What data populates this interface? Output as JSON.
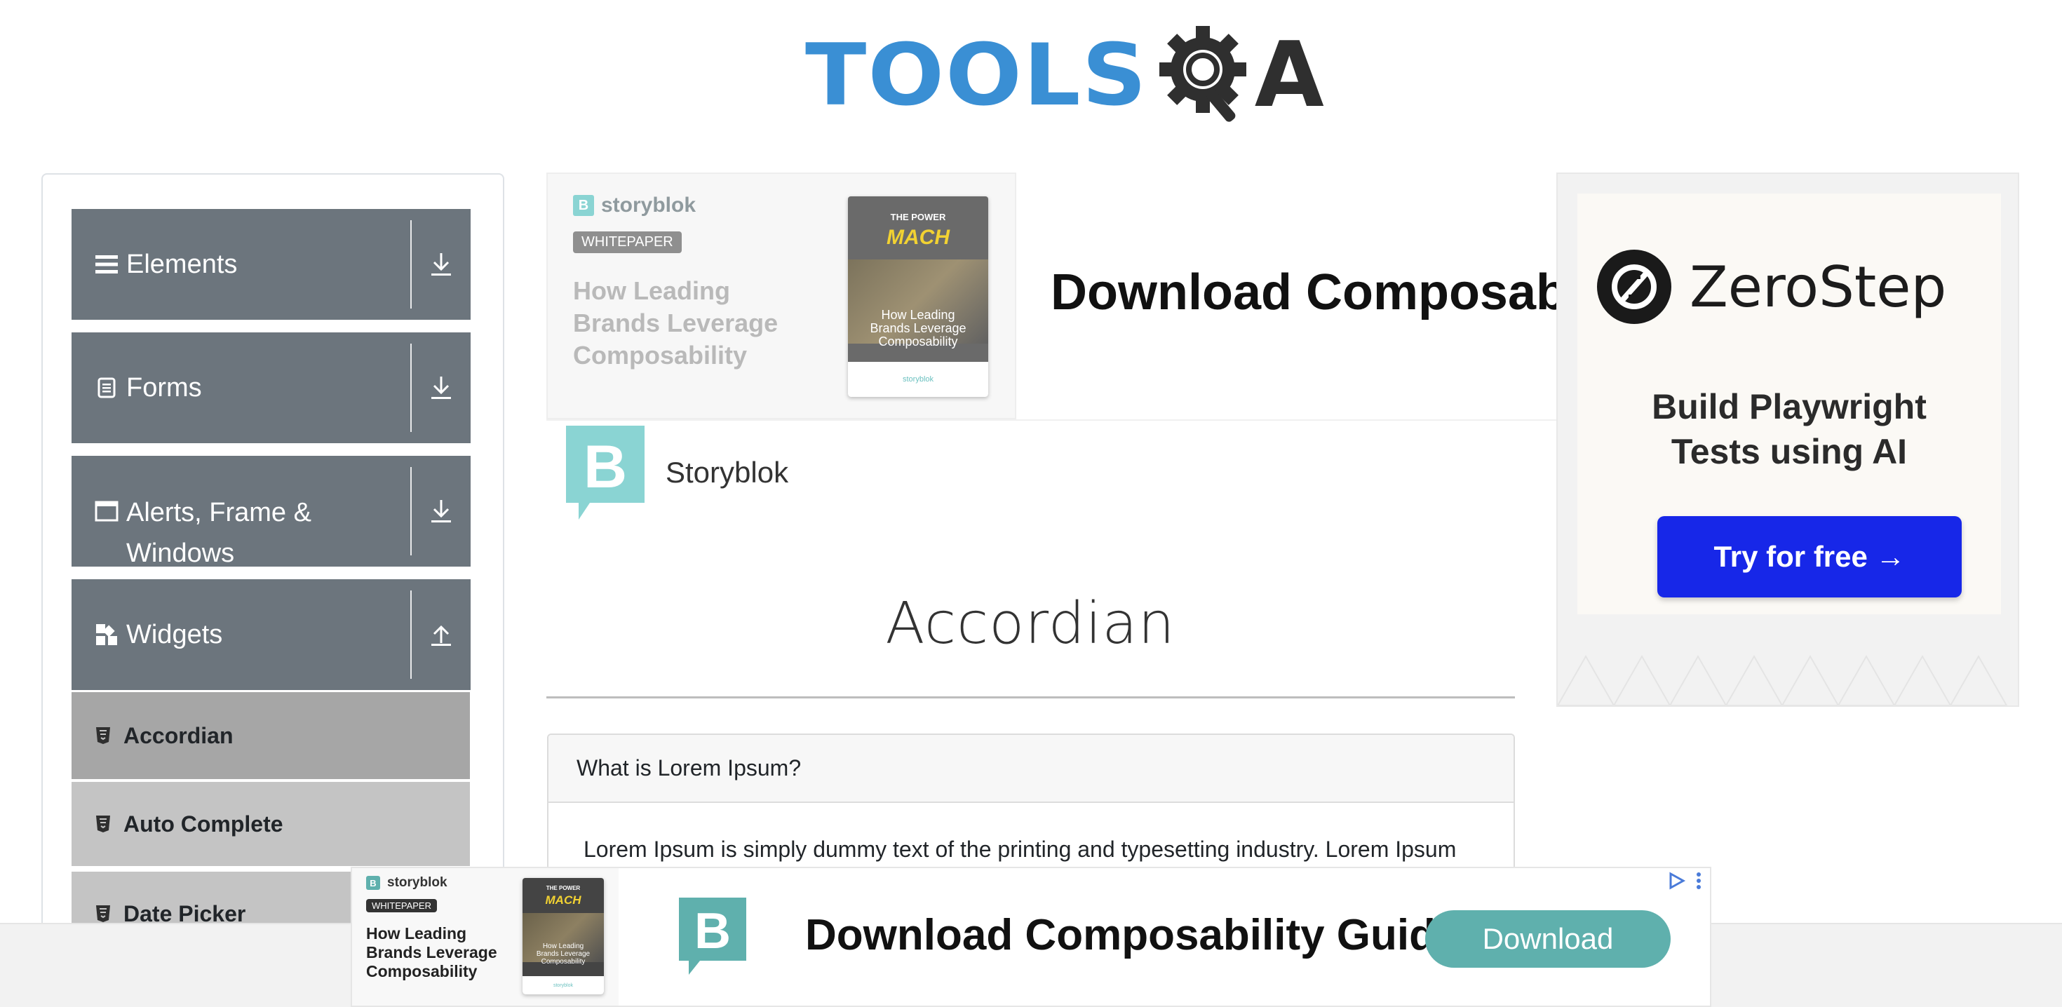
{
  "header": {
    "logo_text": "TOOLS",
    "logo_suffix": "A",
    "logo_alt": "ToolsQA"
  },
  "sidebar": {
    "groups": [
      {
        "label": "Elements",
        "icon": "hamburger-icon",
        "toggle_icon": "download-arrow-icon"
      },
      {
        "label": "Forms",
        "icon": "document-icon",
        "toggle_icon": "download-arrow-icon"
      },
      {
        "label_line1": "Alerts, Frame &",
        "label_line2": "Windows",
        "icon": "window-icon",
        "toggle_icon": "download-arrow-icon"
      },
      {
        "label": "Widgets",
        "icon": "widgets-icon",
        "toggle_icon": "upload-arrow-icon"
      }
    ],
    "items": [
      {
        "label": "Accordian",
        "active": true
      },
      {
        "label": "Auto Complete",
        "active": false
      },
      {
        "label": "Date Picker",
        "active": false
      }
    ]
  },
  "ad_top": {
    "brand": "storyblok",
    "badge": "WHITEPAPER",
    "headline_lines": [
      "How Leading",
      "Brands Leverage",
      "Composability"
    ],
    "book_power": "THE POWER",
    "book_macl": "MACH",
    "book_title_lines": [
      "How Leading",
      "Brands Leverage",
      "Composability"
    ],
    "book_footer": "storyblok",
    "big_text": "Download Composabil",
    "brand_name": "Storyblok"
  },
  "ad_right": {
    "brand": "ZeroStep",
    "tagline_line1": "Build Playwright",
    "tagline_line2": "Tests using AI",
    "cta": "Try for free →",
    "accent": "#1727e8"
  },
  "main": {
    "title": "Accordian",
    "accordion": {
      "header": "What is Lorem Ipsum?",
      "body": "Lorem Ipsum is simply dummy text of the printing and typesetting industry. Lorem Ipsum"
    }
  },
  "ad_bottom": {
    "brand": "storyblok",
    "badge": "WHITEPAPER",
    "headline_lines": [
      "How Leading",
      "Brands Leverage",
      "Composability"
    ],
    "book_power": "THE POWER",
    "book_macl": "MACH",
    "book_title_lines": [
      "How Leading",
      "Brands Leverage",
      "Composability"
    ],
    "book_footer": "storyblok",
    "big_text": "Download Composability Guide",
    "cta": "Download",
    "accent": "#5fb0ad"
  },
  "colors": {
    "sidebar_group_bg": "#6c757d",
    "sidebar_item_bg": "#c4c4c4",
    "sidebar_item_active_bg": "#a6a6a6",
    "logo_blue": "#3a8fd4",
    "storyblok_teal": "#8ad4d3"
  }
}
